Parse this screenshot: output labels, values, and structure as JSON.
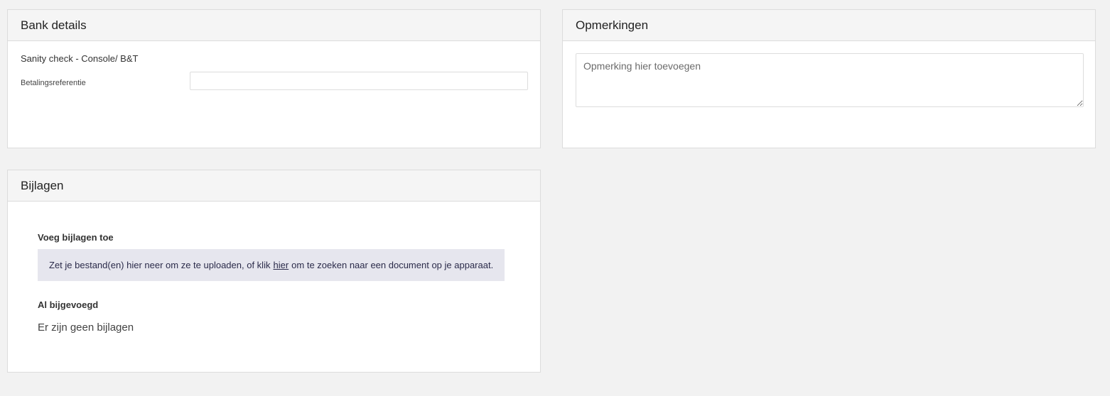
{
  "bank_details": {
    "title": "Bank details",
    "sanity_check": "Sanity check - Console/ B&T",
    "payment_reference_label": "Betalingsreferentie",
    "payment_reference_value": ""
  },
  "remarks": {
    "title": "Opmerkingen",
    "placeholder": "Opmerking hier toevoegen",
    "value": ""
  },
  "attachments": {
    "title": "Bijlagen",
    "add_heading": "Voeg bijlagen toe",
    "dropzone_text_before": "Zet je bestand(en) hier neer om ze te uploaden, of klik",
    "dropzone_link": "hier",
    "dropzone_text_after": "om te zoeken naar een document op je apparaat.",
    "attached_heading": "Al bijgevoegd",
    "empty_text": "Er zijn geen bijlagen"
  }
}
